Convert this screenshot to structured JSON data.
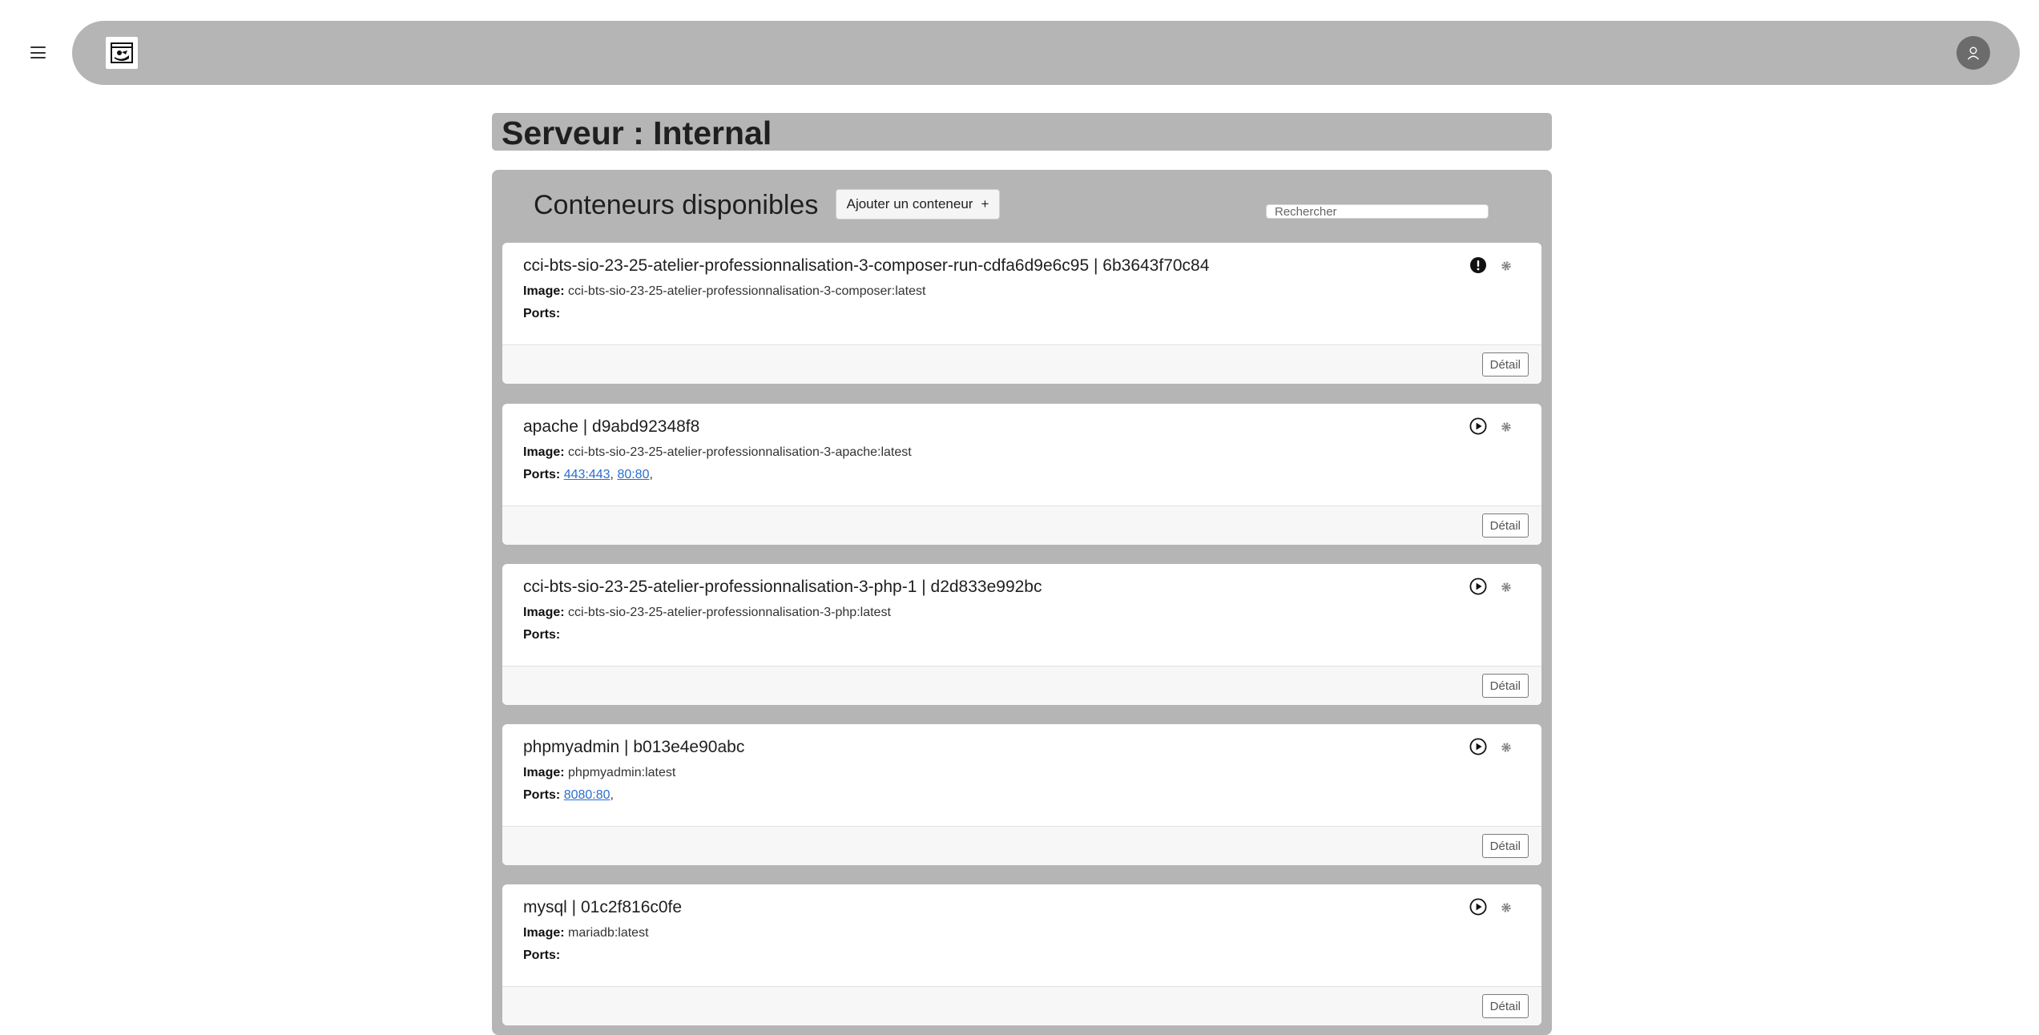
{
  "header": {
    "menu_icon": "hamburger-icon",
    "logo_icon": "app-logo",
    "user_icon": "user-avatar-icon"
  },
  "page": {
    "title": "Serveur : Internal"
  },
  "containers_panel": {
    "title": "Conteneurs disponibles",
    "add_button_label": "Ajouter un conteneur",
    "add_button_icon": "+",
    "search_placeholder": "Rechercher",
    "image_label": "Image:",
    "ports_label": "Ports:",
    "detail_label": "Détail"
  },
  "containers": [
    {
      "title": "cci-bts-sio-23-25-atelier-professionnalisation-3-composer-run-cdfa6d9e6c95 | 6b3643f70c84",
      "image": "cci-bts-sio-23-25-atelier-professionnalisation-3-composer:latest",
      "ports": [],
      "status": "exclamation-icon"
    },
    {
      "title": "apache | d9abd92348f8",
      "image": "cci-bts-sio-23-25-atelier-professionnalisation-3-apache:latest",
      "ports": [
        "443:443",
        "80:80"
      ],
      "status": "play-icon"
    },
    {
      "title": "cci-bts-sio-23-25-atelier-professionnalisation-3-php-1 | d2d833e992bc",
      "image": "cci-bts-sio-23-25-atelier-professionnalisation-3-php:latest",
      "ports": [],
      "status": "play-icon"
    },
    {
      "title": "phpmyadmin | b013e4e90abc",
      "image": "phpmyadmin:latest",
      "ports": [
        "8080:80"
      ],
      "status": "play-icon"
    },
    {
      "title": "mysql | 01c2f816c0fe",
      "image": "mariadb:latest",
      "ports": [],
      "status": "play-icon"
    }
  ],
  "colors": {
    "navbar": "#b5b5b5",
    "panel": "#b5b5b5",
    "link": "#2a6ecf"
  }
}
